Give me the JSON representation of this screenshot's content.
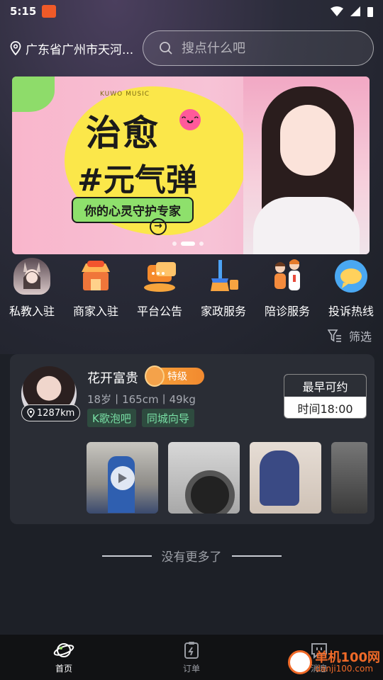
{
  "status_bar": {
    "time": "5:15"
  },
  "header": {
    "location": "广东省广州市天河...",
    "search_placeholder": "搜点什么吧"
  },
  "banner": {
    "brand": "KUWO MUSIC",
    "title_line1": "治愈",
    "title_line2": "#元气弹",
    "tagline": "你的心灵守护专家",
    "active_slide_index": 1,
    "slide_count": 3
  },
  "categories": [
    {
      "label": "私教入驻",
      "icon": "bunny-girl-icon"
    },
    {
      "label": "商家入驻",
      "icon": "shop-icon"
    },
    {
      "label": "平台公告",
      "icon": "announcement-icon"
    },
    {
      "label": "家政服务",
      "icon": "cleaning-icon"
    },
    {
      "label": "陪诊服务",
      "icon": "doctor-icon"
    },
    {
      "label": "投诉热线",
      "icon": "chat-bubble-icon"
    }
  ],
  "filter": {
    "label": "筛选"
  },
  "profile_card": {
    "name": "花开富贵",
    "level": "特级",
    "distance": "1287km",
    "meta": "18岁丨165cm丨49kg",
    "tags": [
      "K歌泡吧",
      "同城向导"
    ],
    "availability_title": "最早可约",
    "availability_time": "时间18:00"
  },
  "no_more": "没有更多了",
  "bottom_nav": [
    {
      "label": "首页",
      "icon": "planet-icon",
      "active": true
    },
    {
      "label": "订单",
      "icon": "order-icon",
      "active": false
    },
    {
      "label": "消息",
      "icon": "message-icon",
      "active": false
    }
  ],
  "watermark": {
    "line1": "单机100网",
    "line2": "danji100.com"
  },
  "colors": {
    "background": "#1d2027",
    "card": "#2a2d35",
    "tag_bg": "#2e4b3f",
    "tag_text": "#79e0a6",
    "level": "#f28a2f"
  }
}
